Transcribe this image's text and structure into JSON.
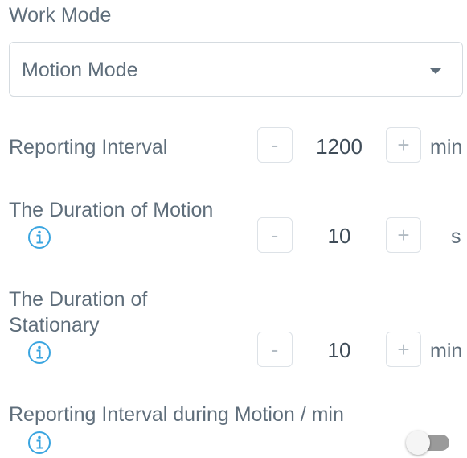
{
  "work_mode": {
    "label": "Work Mode",
    "selected": "Motion Mode"
  },
  "reporting_interval": {
    "label": "Reporting Interval",
    "minus": "-",
    "value": "1200",
    "plus": "+",
    "unit": "min"
  },
  "duration_motion": {
    "label": "The Duration of Motion",
    "minus": "-",
    "value": "10",
    "plus": "+",
    "unit": "s"
  },
  "duration_stationary": {
    "label_line1": "The Duration of",
    "label_line2": "Stationary",
    "minus": "-",
    "value": "10",
    "plus": "+",
    "unit": "min"
  },
  "reporting_interval_motion": {
    "label": "Reporting Interval during Motion / min",
    "toggle_on": false
  },
  "colors": {
    "text": "#5f6e7b",
    "value_text": "#3f4c58",
    "info_icon": "#3aa5e0",
    "border": "#d5dbe0",
    "toggle_track_off": "#9a9a9a"
  }
}
